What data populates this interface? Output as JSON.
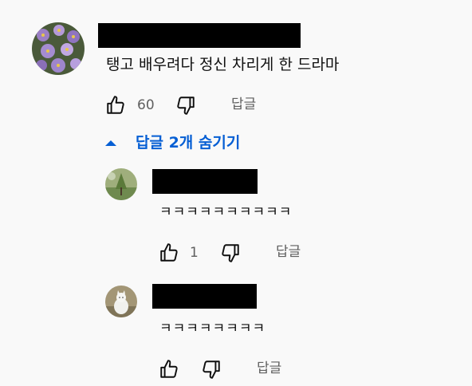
{
  "comment": {
    "text": "탱고 배우려다 정신 차리게 한 드라마",
    "like_count": "60",
    "reply_label": "답글",
    "like_icon": "thumbs-up-icon",
    "dislike_icon": "thumbs-down-icon"
  },
  "replies_toggle": {
    "label": "답글 2개 숨기기",
    "icon": "caret-up-icon",
    "color": "#065fd4"
  },
  "replies": [
    {
      "text": "ㅋㅋㅋㅋㅋㅋㅋㅋㅋㅋ",
      "like_count": "1",
      "reply_label": "답글"
    },
    {
      "text": "ㅋㅋㅋㅋㅋㅋㅋㅋ",
      "like_count": "",
      "reply_label": "답글"
    }
  ]
}
